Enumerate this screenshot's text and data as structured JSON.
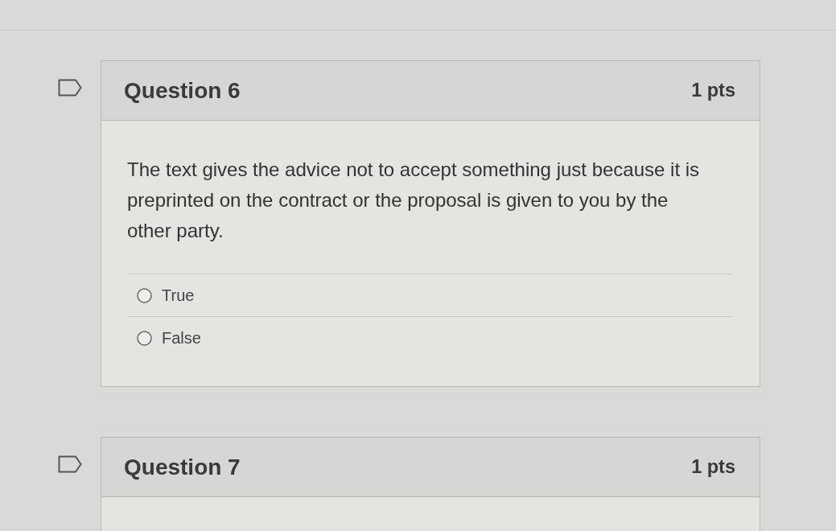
{
  "questions": [
    {
      "title": "Question 6",
      "points": "1 pts",
      "flagged": false,
      "text": "The text gives the advice not to accept something just because it is preprinted on the contract or the proposal is given to you by the other party.",
      "answers": [
        {
          "label": "True",
          "selected": false
        },
        {
          "label": "False",
          "selected": false
        }
      ]
    },
    {
      "title": "Question 7",
      "points": "1 pts",
      "flagged": false
    }
  ]
}
